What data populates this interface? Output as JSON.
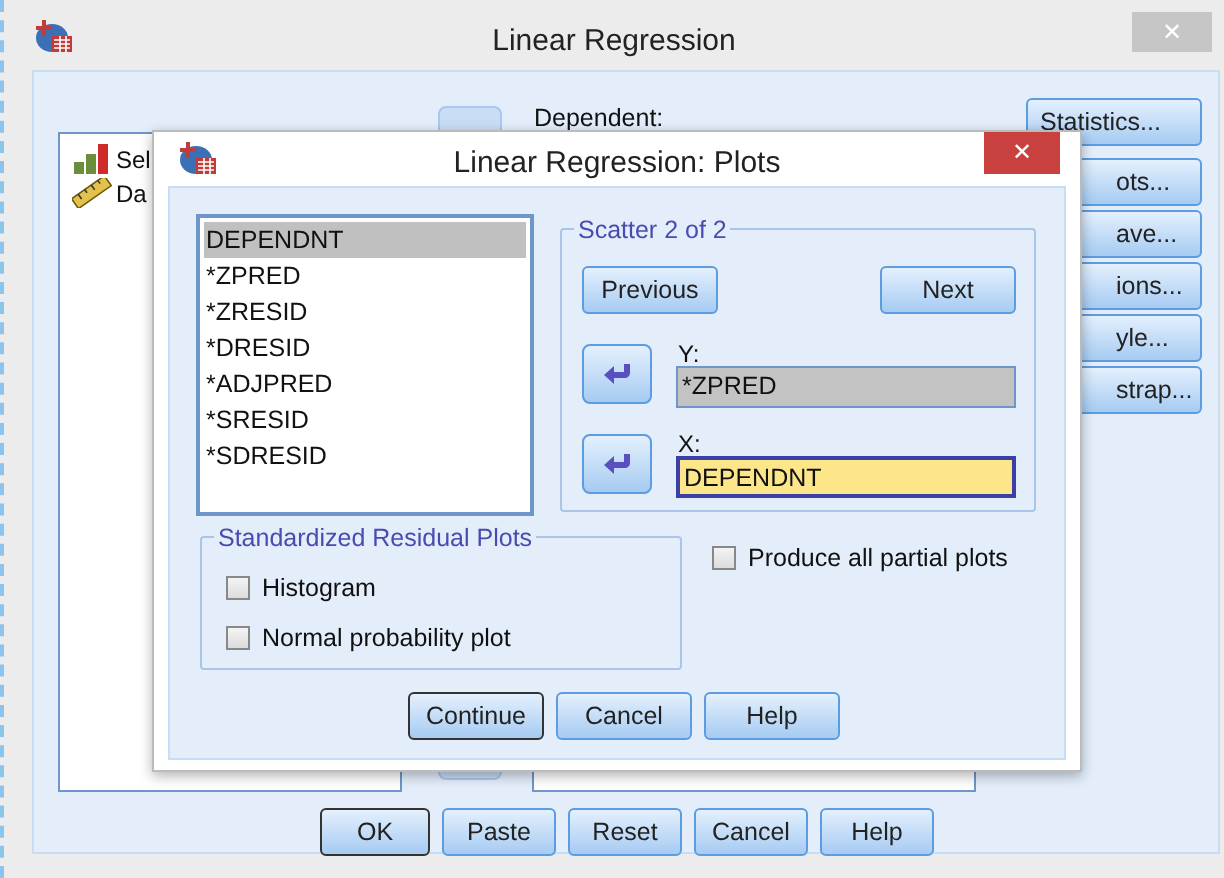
{
  "main_window": {
    "title": "Linear Regression",
    "close": "✕",
    "source_list": [
      {
        "label": "Sel",
        "kind": "scale"
      },
      {
        "label": "Da",
        "kind": "ruler"
      }
    ],
    "dependent_label": "Dependent:",
    "side_buttons": [
      "Statistics...",
      "ots...",
      "ave...",
      "ions...",
      "yle...",
      "strap..."
    ],
    "buttons": [
      {
        "label": "OK",
        "default": true
      },
      {
        "label": "Paste",
        "default": false
      },
      {
        "label": "Reset",
        "default": false
      },
      {
        "label": "Cancel",
        "default": false
      },
      {
        "label": "Help",
        "default": false
      }
    ]
  },
  "plots_dialog": {
    "title": "Linear Regression: Plots",
    "close": "✕",
    "variables": [
      {
        "label": "DEPENDNT",
        "selected": true
      },
      {
        "label": "*ZPRED",
        "selected": false
      },
      {
        "label": "*ZRESID",
        "selected": false
      },
      {
        "label": "*DRESID",
        "selected": false
      },
      {
        "label": "*ADJPRED",
        "selected": false
      },
      {
        "label": "*SRESID",
        "selected": false
      },
      {
        "label": "*SDRESID",
        "selected": false
      }
    ],
    "scatter": {
      "title": "Scatter 2 of 2",
      "previous": "Previous",
      "next": "Next",
      "fields": [
        {
          "label": "Y:",
          "value": "*ZPRED",
          "active": false
        },
        {
          "label": "X:",
          "value": "DEPENDNT",
          "active": true
        }
      ]
    },
    "residual_plots": {
      "title": "Standardized Residual Plots",
      "options": [
        {
          "label": "Histogram",
          "checked": false
        },
        {
          "label": "Normal probability plot",
          "checked": false
        }
      ]
    },
    "partial_plots": {
      "label": "Produce all partial plots",
      "checked": false
    },
    "buttons": [
      {
        "label": "Continue",
        "default": true
      },
      {
        "label": "Cancel",
        "default": false
      },
      {
        "label": "Help",
        "default": false
      }
    ]
  }
}
